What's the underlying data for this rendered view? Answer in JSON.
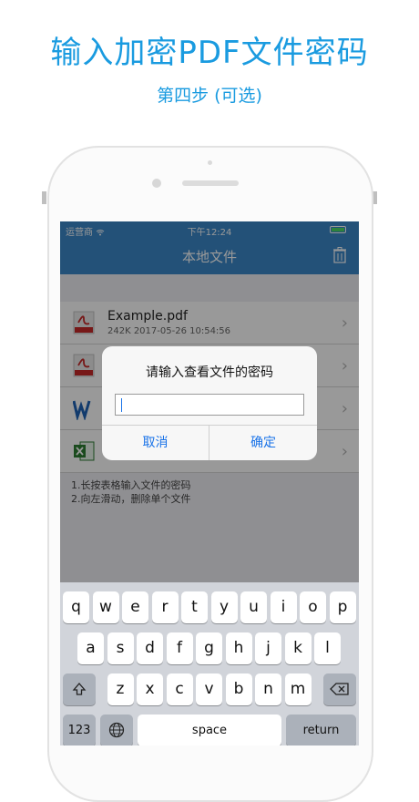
{
  "promo": {
    "title": "输入加密PDF文件密码",
    "subtitle": "第四步 (可选)"
  },
  "status_bar": {
    "carrier": "运营商 ",
    "time": "下午12:24"
  },
  "nav": {
    "title": "本地文件"
  },
  "files": [
    {
      "name": "Example.pdf",
      "meta": "242K  2017-05-26 10:54:56",
      "icon": "pdf-icon"
    },
    {
      "name": "",
      "meta": "",
      "icon": "pdf-icon"
    },
    {
      "name": "",
      "meta": "",
      "icon": "word-icon"
    },
    {
      "name": "",
      "meta": "",
      "icon": "excel-icon"
    }
  ],
  "hint": {
    "line1": "1.长按表格输入文件的密码",
    "line2": "2.向左滑动，删除单个文件"
  },
  "alert": {
    "title": "请输入查看文件的密码",
    "input_value": "",
    "cancel": "取消",
    "confirm": "确定"
  },
  "keyboard": {
    "row1": [
      "q",
      "w",
      "e",
      "r",
      "t",
      "y",
      "u",
      "i",
      "o",
      "p"
    ],
    "row2": [
      "a",
      "s",
      "d",
      "f",
      "g",
      "h",
      "j",
      "k",
      "l"
    ],
    "row3": [
      "z",
      "x",
      "c",
      "v",
      "b",
      "n",
      "m"
    ],
    "mode_key": "123",
    "space": "space",
    "return": "return"
  },
  "colors": {
    "accent": "#1a9be0",
    "nav_bar": "#3b87c8",
    "link": "#1a73e8"
  }
}
